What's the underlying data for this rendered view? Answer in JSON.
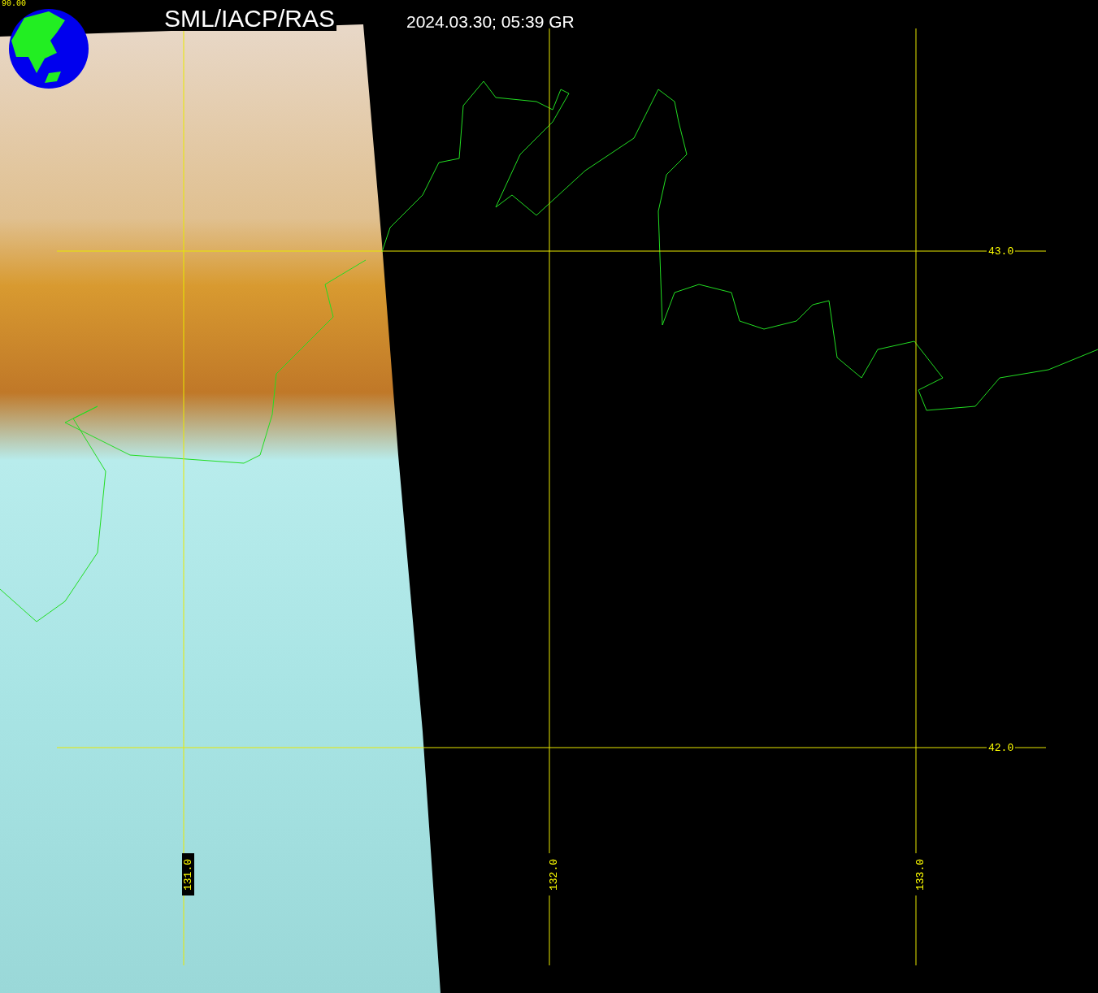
{
  "corner_label": "90.00",
  "header": {
    "source": "SML/IACP/RAS",
    "timestamp": "2024.03.30; 05:39 GR"
  },
  "latitude_labels": [
    "43.0",
    "42.0"
  ],
  "longitude_labels": [
    "131.0",
    "132.0",
    "133.0"
  ]
}
